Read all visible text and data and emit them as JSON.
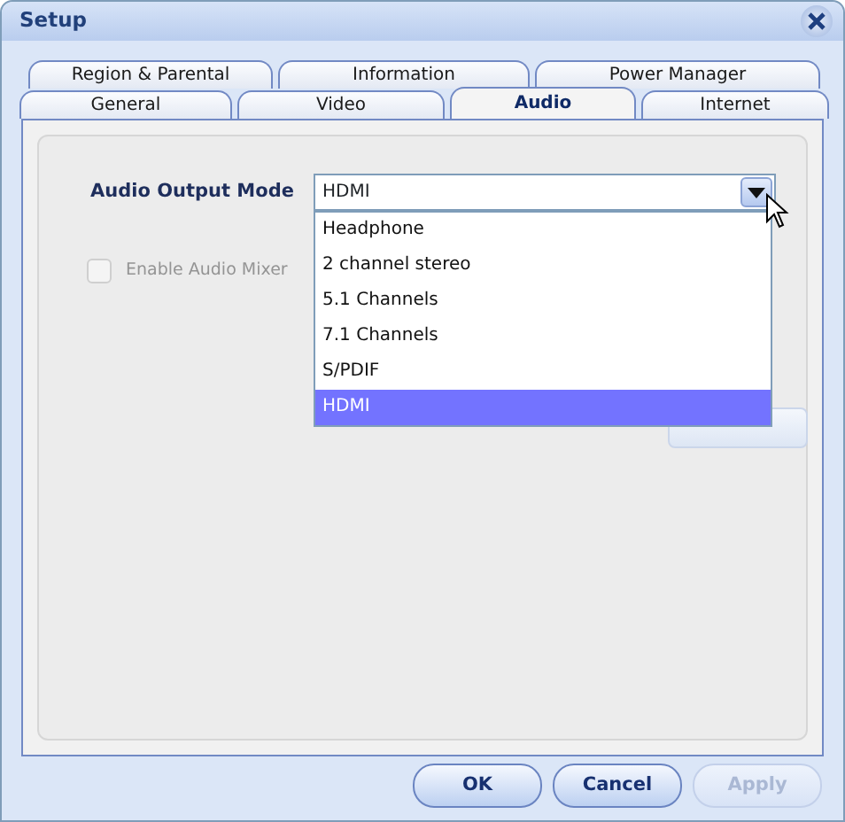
{
  "window": {
    "title": "Setup"
  },
  "tab_rows": [
    [
      {
        "label": "Region & Parental",
        "selected": false
      },
      {
        "label": "Information",
        "selected": false
      },
      {
        "label": "Power Manager",
        "selected": false
      }
    ],
    [
      {
        "label": "General",
        "selected": false
      },
      {
        "label": "Video",
        "selected": false
      },
      {
        "label": "Audio",
        "selected": true
      },
      {
        "label": "Internet",
        "selected": false
      }
    ]
  ],
  "audio_output_mode": {
    "label": "Audio Output Mode",
    "value": "HDMI",
    "expanded": true,
    "options": [
      {
        "label": "Headphone",
        "selected": false
      },
      {
        "label": "2 channel stereo",
        "selected": false
      },
      {
        "label": "5.1 Channels",
        "selected": false
      },
      {
        "label": "7.1 Channels",
        "selected": false
      },
      {
        "label": "S/PDIF",
        "selected": false
      },
      {
        "label": "HDMI",
        "selected": true
      }
    ]
  },
  "enable_audio_mixer": {
    "label": "Enable Audio Mixer",
    "checked": false,
    "disabled": true
  },
  "advanced_button": {
    "disabled": true
  },
  "buttons": [
    {
      "label": "OK",
      "disabled": false
    },
    {
      "label": "Cancel",
      "disabled": false
    },
    {
      "label": "Apply",
      "disabled": true
    }
  ]
}
